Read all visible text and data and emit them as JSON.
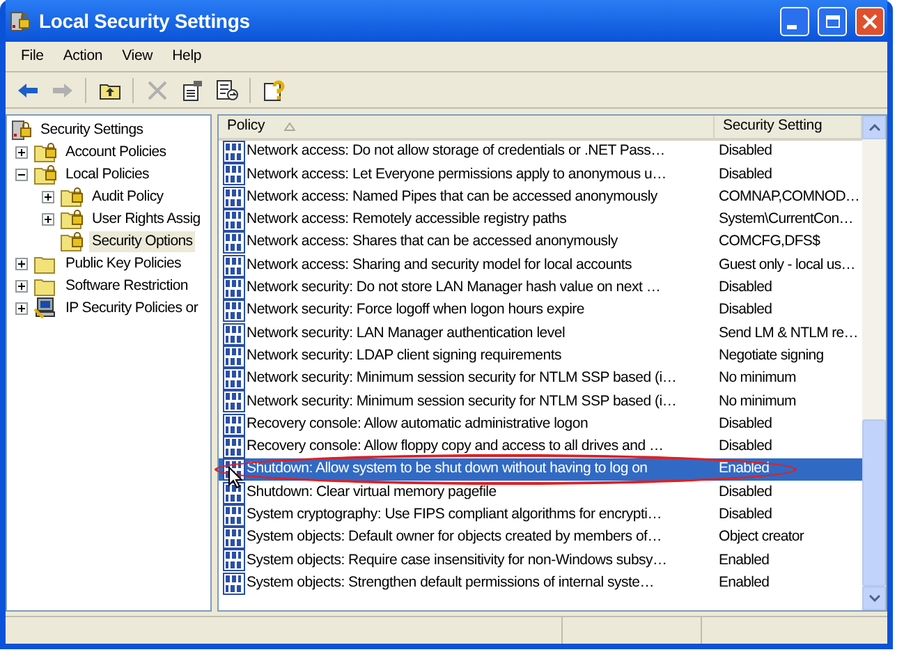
{
  "window": {
    "title": "Local Security Settings"
  },
  "menu": [
    "File",
    "Action",
    "View",
    "Help"
  ],
  "toolbar": [
    {
      "kind": "back",
      "disabled": false
    },
    {
      "kind": "forward",
      "disabled": true
    },
    {
      "kind": "up",
      "disabled": false
    },
    {
      "kind": "delete",
      "disabled": true
    },
    {
      "kind": "properties",
      "disabled": false
    },
    {
      "kind": "export",
      "disabled": false
    },
    {
      "kind": "help",
      "disabled": false
    }
  ],
  "tree": [
    {
      "label": "Security Settings",
      "kind": "root",
      "selected": false,
      "children": [
        {
          "label": "Account Policies",
          "kind": "locked_folder",
          "expanded": false,
          "selected": false
        },
        {
          "label": "Local Policies",
          "kind": "locked_folder",
          "expanded": true,
          "selected": false,
          "children": [
            {
              "label": "Audit Policy",
              "kind": "locked_folder",
              "expanded": false,
              "selected": false
            },
            {
              "label": "User Rights Assig",
              "kind": "locked_folder",
              "expanded": false,
              "selected": false
            },
            {
              "label": "Security Options",
              "kind": "locked_folder",
              "selected": true
            }
          ]
        },
        {
          "label": "Public Key Policies",
          "kind": "folder",
          "expanded": false,
          "selected": false
        },
        {
          "label": "Software Restriction",
          "kind": "folder",
          "expanded": false,
          "selected": false
        },
        {
          "label": "IP Security Policies or",
          "kind": "ip_security",
          "expanded": false,
          "selected": false
        }
      ]
    }
  ],
  "table": {
    "columns": [
      "Policy",
      "Security Setting"
    ],
    "rows": [
      {
        "policy": "Network access: Do not allow storage of credentials or .NET Pass…",
        "setting": "Disabled",
        "selected": false
      },
      {
        "policy": "Network access: Let Everyone permissions apply to anonymous u…",
        "setting": "Disabled",
        "selected": false
      },
      {
        "policy": "Network access: Named Pipes that can be accessed anonymously",
        "setting": "COMNAP,COMNOD…",
        "selected": false
      },
      {
        "policy": "Network access: Remotely accessible registry paths",
        "setting": "System\\CurrentCon…",
        "selected": false
      },
      {
        "policy": "Network access: Shares that can be accessed anonymously",
        "setting": "COMCFG,DFS$",
        "selected": false
      },
      {
        "policy": "Network access: Sharing and security model for local accounts",
        "setting": "Guest only - local us…",
        "selected": false
      },
      {
        "policy": "Network security: Do not store LAN Manager hash value on next …",
        "setting": "Disabled",
        "selected": false
      },
      {
        "policy": "Network security: Force logoff when logon hours expire",
        "setting": "Disabled",
        "selected": false
      },
      {
        "policy": "Network security: LAN Manager authentication level",
        "setting": "Send LM & NTLM re…",
        "selected": false
      },
      {
        "policy": "Network security: LDAP client signing requirements",
        "setting": "Negotiate signing",
        "selected": false
      },
      {
        "policy": "Network security: Minimum session security for NTLM SSP based (i…",
        "setting": "No minimum",
        "selected": false
      },
      {
        "policy": "Network security: Minimum session security for NTLM SSP based (i…",
        "setting": "No minimum",
        "selected": false
      },
      {
        "policy": "Recovery console: Allow automatic administrative logon",
        "setting": "Disabled",
        "selected": false
      },
      {
        "policy": "Recovery console: Allow floppy copy and access to all drives and …",
        "setting": "Disabled",
        "selected": false
      },
      {
        "policy": "Shutdown: Allow system to be shut down without having to log on",
        "setting": "Enabled",
        "selected": true
      },
      {
        "policy": "Shutdown: Clear virtual memory pagefile",
        "setting": "Disabled",
        "selected": false
      },
      {
        "policy": "System cryptography: Use FIPS compliant algorithms for encrypti…",
        "setting": "Disabled",
        "selected": false
      },
      {
        "policy": "System objects: Default owner for objects created by members of…",
        "setting": "Object creator",
        "selected": false
      },
      {
        "policy": "System objects: Require case insensitivity for non-Windows subsy…",
        "setting": "Enabled",
        "selected": false
      },
      {
        "policy": "System objects: Strengthen default permissions of internal syste…",
        "setting": "Enabled",
        "selected": false
      }
    ]
  }
}
